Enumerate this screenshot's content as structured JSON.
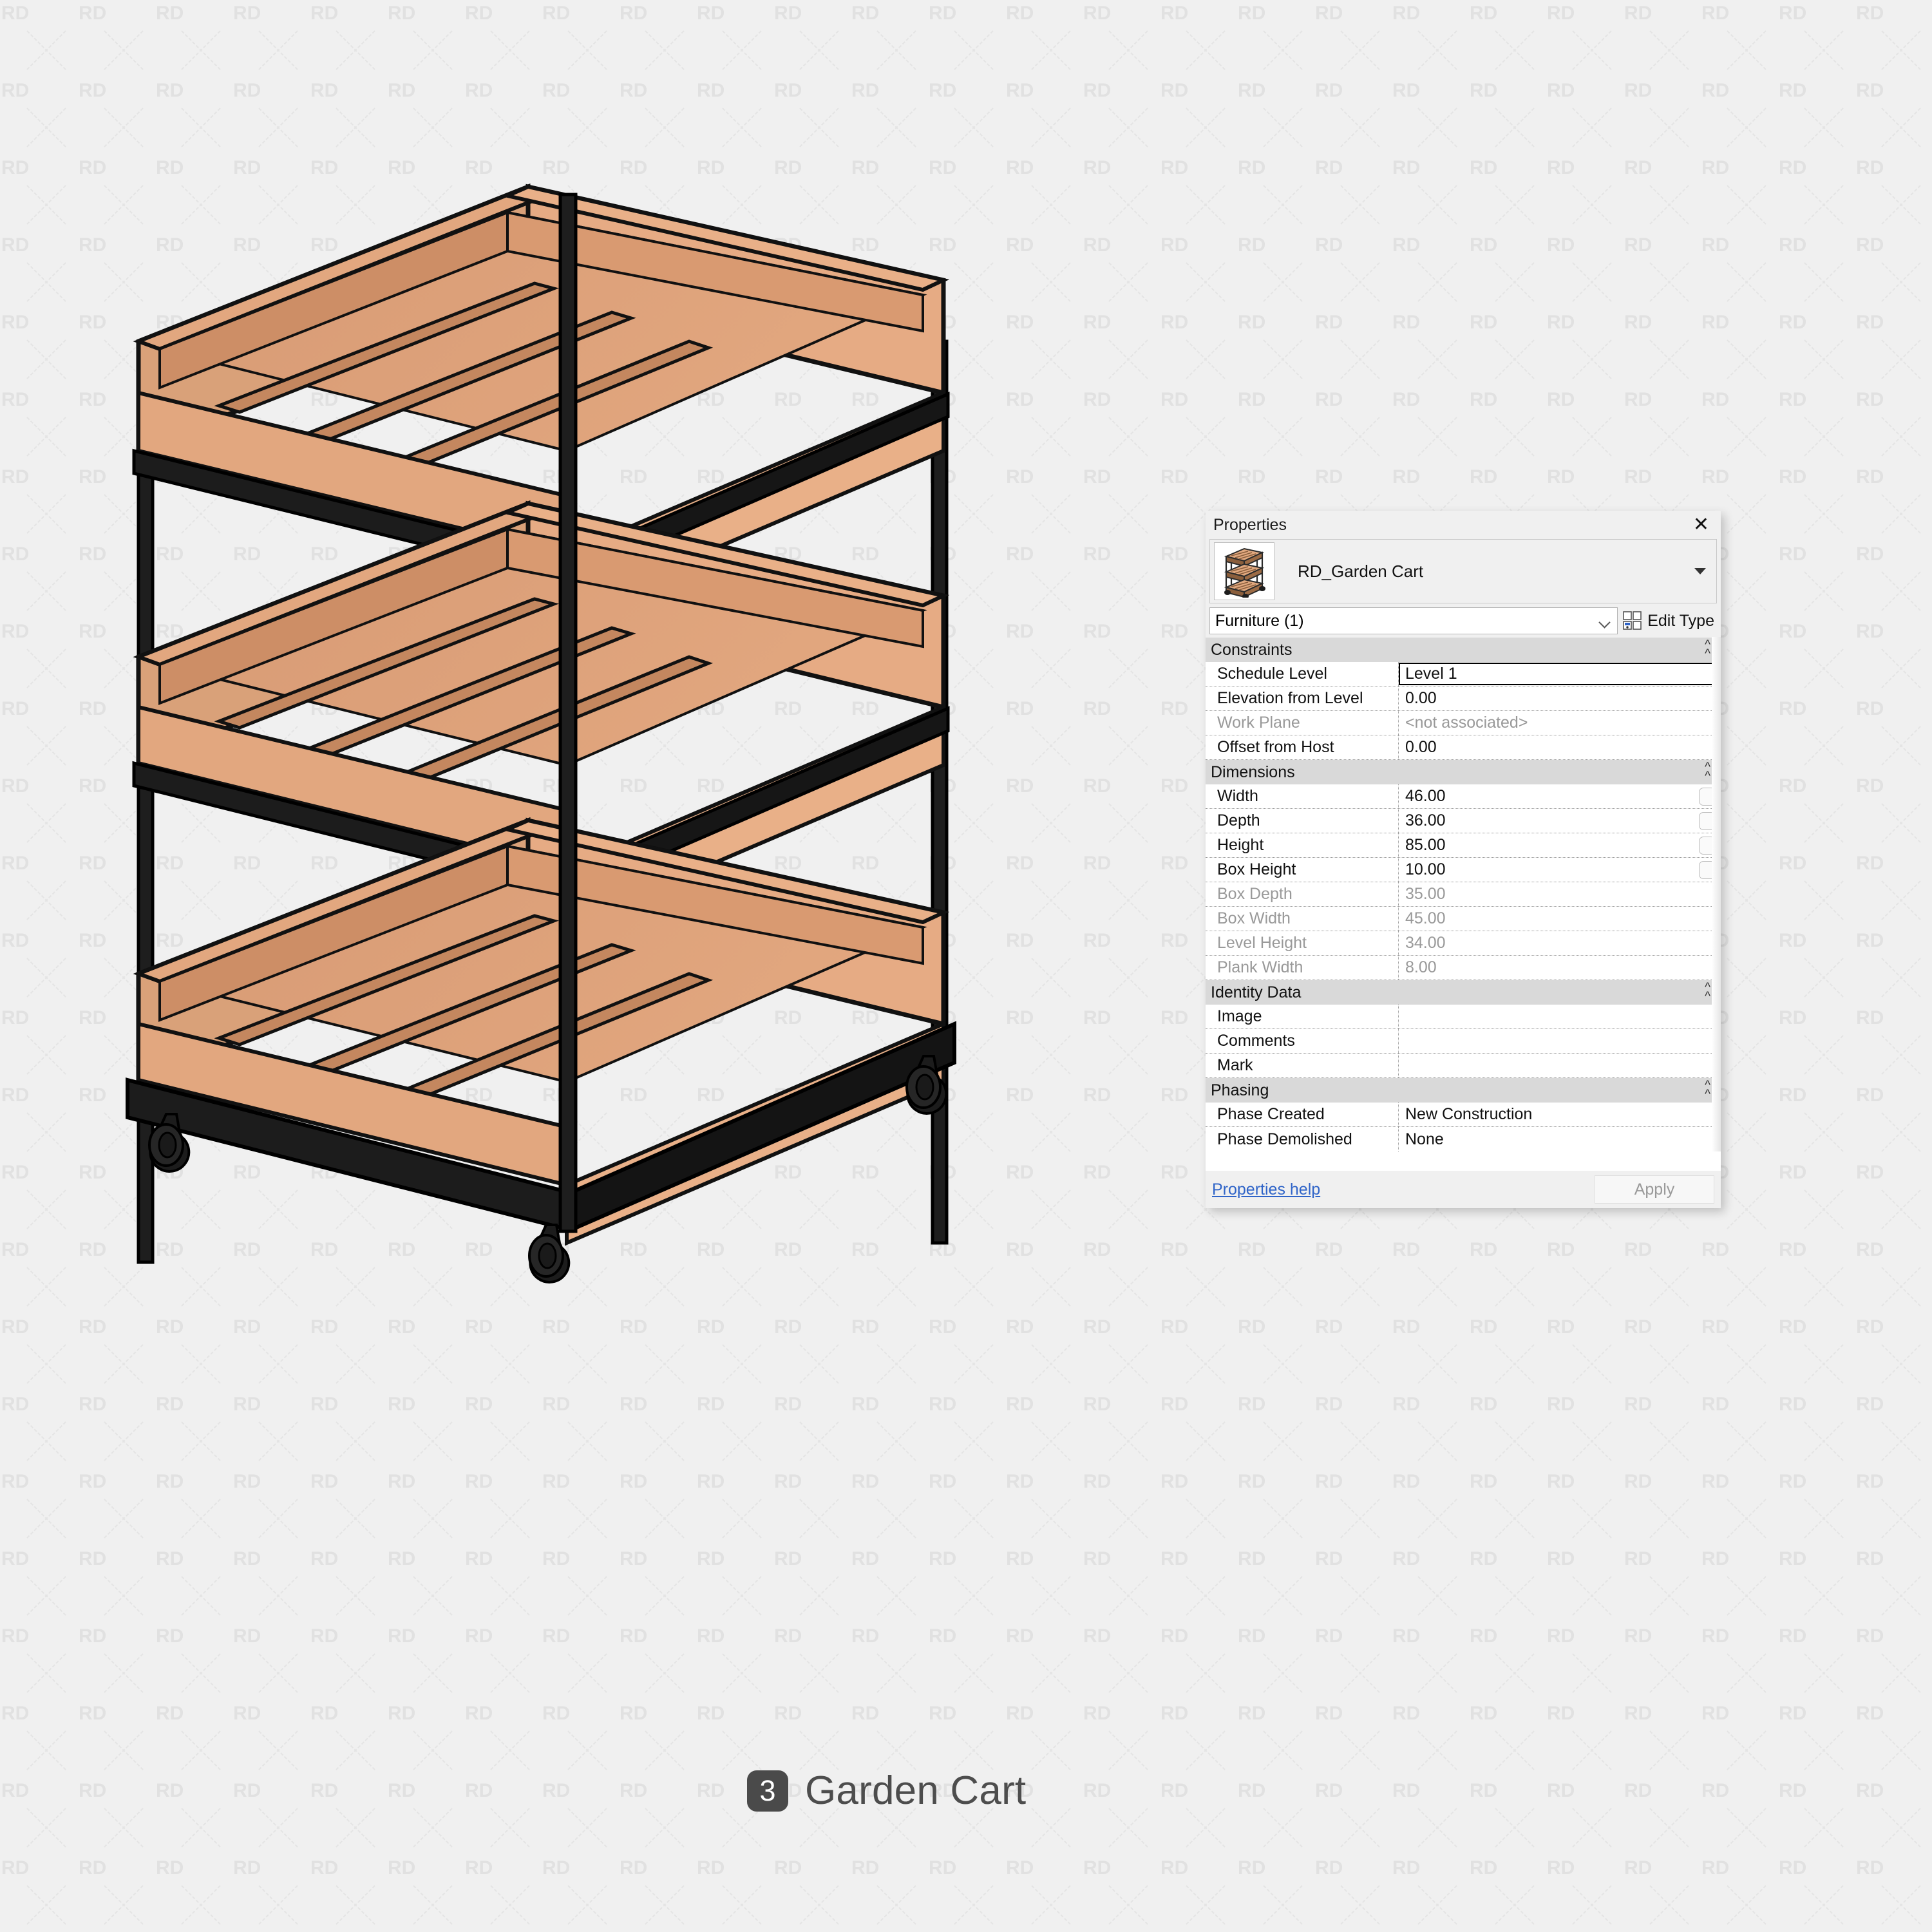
{
  "caption": {
    "badge_number": "3",
    "title": "Garden Cart"
  },
  "watermark": {
    "text": "RD",
    "background_color": "#f0f0f0",
    "mark_color": "#e2e2e2"
  },
  "model": {
    "name": "RD_Garden Cart 3D view",
    "wood_light": "#e6ab84",
    "wood_mid": "#d79a74",
    "wood_dark": "#c98f6a",
    "frame_color": "#1f1f1f",
    "shelf_count": 3,
    "caster_count": 4
  },
  "properties_panel": {
    "title": "Properties",
    "close_label": "✕",
    "type_name": "RD_Garden Cart",
    "category_selector": "Furniture (1)",
    "edit_type_label": "Edit Type",
    "help_link": "Properties help",
    "apply_label": "Apply",
    "groups": [
      {
        "name": "Constraints",
        "rows": [
          {
            "key": "Schedule Level",
            "value": "Level 1",
            "state": "selected"
          },
          {
            "key": "Elevation from Level",
            "value": "0.00",
            "state": "normal"
          },
          {
            "key": "Work Plane",
            "value": "<not associated>",
            "state": "muted"
          },
          {
            "key": "Offset from Host",
            "value": "0.00",
            "state": "normal"
          }
        ]
      },
      {
        "name": "Dimensions",
        "rows": [
          {
            "key": "Width",
            "value": "46.00",
            "state": "normal",
            "assoc": true
          },
          {
            "key": "Depth",
            "value": "36.00",
            "state": "normal",
            "assoc": true
          },
          {
            "key": "Height",
            "value": "85.00",
            "state": "normal",
            "assoc": true
          },
          {
            "key": "Box Height",
            "value": "10.00",
            "state": "normal",
            "assoc": true
          },
          {
            "key": "Box Depth",
            "value": "35.00",
            "state": "muted"
          },
          {
            "key": "Box Width",
            "value": "45.00",
            "state": "muted"
          },
          {
            "key": "Level Height",
            "value": "34.00",
            "state": "muted"
          },
          {
            "key": "Plank Width",
            "value": "8.00",
            "state": "muted"
          }
        ]
      },
      {
        "name": "Identity Data",
        "rows": [
          {
            "key": "Image",
            "value": "",
            "state": "normal"
          },
          {
            "key": "Comments",
            "value": "",
            "state": "normal"
          },
          {
            "key": "Mark",
            "value": "",
            "state": "normal"
          }
        ]
      },
      {
        "name": "Phasing",
        "rows": [
          {
            "key": "Phase Created",
            "value": "New Construction",
            "state": "normal"
          },
          {
            "key": "Phase Demolished",
            "value": "None",
            "state": "normal"
          }
        ]
      }
    ]
  }
}
